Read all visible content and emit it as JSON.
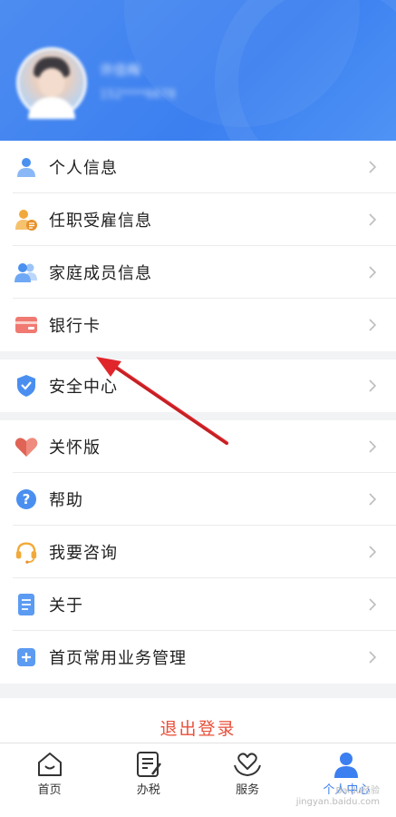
{
  "profile": {
    "name": "许佳梅",
    "phone": "152****6678"
  },
  "group1": [
    {
      "label": "个人信息",
      "icon": "person-icon"
    },
    {
      "label": "任职受雇信息",
      "icon": "employment-icon"
    },
    {
      "label": "家庭成员信息",
      "icon": "family-icon"
    },
    {
      "label": "银行卡",
      "icon": "bank-card-icon"
    }
  ],
  "group2": [
    {
      "label": "安全中心",
      "icon": "shield-icon"
    }
  ],
  "group3": [
    {
      "label": "关怀版",
      "icon": "heart-icon"
    },
    {
      "label": "帮助",
      "icon": "help-icon"
    },
    {
      "label": "我要咨询",
      "icon": "headset-icon"
    },
    {
      "label": "关于",
      "icon": "document-icon"
    },
    {
      "label": "首页常用业务管理",
      "icon": "plus-icon"
    }
  ],
  "logout": "退出登录",
  "tabs": [
    {
      "label": "首页",
      "icon": "home-icon"
    },
    {
      "label": "办税",
      "icon": "tax-icon"
    },
    {
      "label": "服务",
      "icon": "service-icon"
    },
    {
      "label": "个人中心",
      "icon": "profile-icon"
    }
  ],
  "watermark": {
    "line1": "Baidu经验",
    "line2": "jingyan.baidu.com"
  },
  "colors": {
    "primary": "#3b7ff0",
    "logout": "#e8503a",
    "arrow": "#e0262b"
  }
}
